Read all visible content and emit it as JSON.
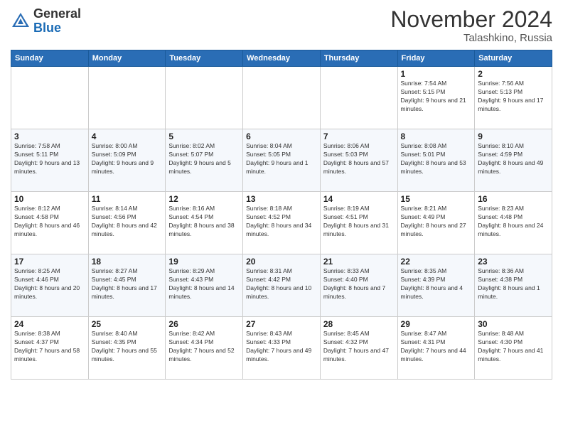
{
  "header": {
    "logo_general": "General",
    "logo_blue": "Blue",
    "month_title": "November 2024",
    "location": "Talashkino, Russia"
  },
  "calendar": {
    "days_of_week": [
      "Sunday",
      "Monday",
      "Tuesday",
      "Wednesday",
      "Thursday",
      "Friday",
      "Saturday"
    ],
    "weeks": [
      [
        {
          "day": "",
          "info": ""
        },
        {
          "day": "",
          "info": ""
        },
        {
          "day": "",
          "info": ""
        },
        {
          "day": "",
          "info": ""
        },
        {
          "day": "",
          "info": ""
        },
        {
          "day": "1",
          "info": "Sunrise: 7:54 AM\nSunset: 5:15 PM\nDaylight: 9 hours and 21 minutes."
        },
        {
          "day": "2",
          "info": "Sunrise: 7:56 AM\nSunset: 5:13 PM\nDaylight: 9 hours and 17 minutes."
        }
      ],
      [
        {
          "day": "3",
          "info": "Sunrise: 7:58 AM\nSunset: 5:11 PM\nDaylight: 9 hours and 13 minutes."
        },
        {
          "day": "4",
          "info": "Sunrise: 8:00 AM\nSunset: 5:09 PM\nDaylight: 9 hours and 9 minutes."
        },
        {
          "day": "5",
          "info": "Sunrise: 8:02 AM\nSunset: 5:07 PM\nDaylight: 9 hours and 5 minutes."
        },
        {
          "day": "6",
          "info": "Sunrise: 8:04 AM\nSunset: 5:05 PM\nDaylight: 9 hours and 1 minute."
        },
        {
          "day": "7",
          "info": "Sunrise: 8:06 AM\nSunset: 5:03 PM\nDaylight: 8 hours and 57 minutes."
        },
        {
          "day": "8",
          "info": "Sunrise: 8:08 AM\nSunset: 5:01 PM\nDaylight: 8 hours and 53 minutes."
        },
        {
          "day": "9",
          "info": "Sunrise: 8:10 AM\nSunset: 4:59 PM\nDaylight: 8 hours and 49 minutes."
        }
      ],
      [
        {
          "day": "10",
          "info": "Sunrise: 8:12 AM\nSunset: 4:58 PM\nDaylight: 8 hours and 46 minutes."
        },
        {
          "day": "11",
          "info": "Sunrise: 8:14 AM\nSunset: 4:56 PM\nDaylight: 8 hours and 42 minutes."
        },
        {
          "day": "12",
          "info": "Sunrise: 8:16 AM\nSunset: 4:54 PM\nDaylight: 8 hours and 38 minutes."
        },
        {
          "day": "13",
          "info": "Sunrise: 8:18 AM\nSunset: 4:52 PM\nDaylight: 8 hours and 34 minutes."
        },
        {
          "day": "14",
          "info": "Sunrise: 8:19 AM\nSunset: 4:51 PM\nDaylight: 8 hours and 31 minutes."
        },
        {
          "day": "15",
          "info": "Sunrise: 8:21 AM\nSunset: 4:49 PM\nDaylight: 8 hours and 27 minutes."
        },
        {
          "day": "16",
          "info": "Sunrise: 8:23 AM\nSunset: 4:48 PM\nDaylight: 8 hours and 24 minutes."
        }
      ],
      [
        {
          "day": "17",
          "info": "Sunrise: 8:25 AM\nSunset: 4:46 PM\nDaylight: 8 hours and 20 minutes."
        },
        {
          "day": "18",
          "info": "Sunrise: 8:27 AM\nSunset: 4:45 PM\nDaylight: 8 hours and 17 minutes."
        },
        {
          "day": "19",
          "info": "Sunrise: 8:29 AM\nSunset: 4:43 PM\nDaylight: 8 hours and 14 minutes."
        },
        {
          "day": "20",
          "info": "Sunrise: 8:31 AM\nSunset: 4:42 PM\nDaylight: 8 hours and 10 minutes."
        },
        {
          "day": "21",
          "info": "Sunrise: 8:33 AM\nSunset: 4:40 PM\nDaylight: 8 hours and 7 minutes."
        },
        {
          "day": "22",
          "info": "Sunrise: 8:35 AM\nSunset: 4:39 PM\nDaylight: 8 hours and 4 minutes."
        },
        {
          "day": "23",
          "info": "Sunrise: 8:36 AM\nSunset: 4:38 PM\nDaylight: 8 hours and 1 minute."
        }
      ],
      [
        {
          "day": "24",
          "info": "Sunrise: 8:38 AM\nSunset: 4:37 PM\nDaylight: 7 hours and 58 minutes."
        },
        {
          "day": "25",
          "info": "Sunrise: 8:40 AM\nSunset: 4:35 PM\nDaylight: 7 hours and 55 minutes."
        },
        {
          "day": "26",
          "info": "Sunrise: 8:42 AM\nSunset: 4:34 PM\nDaylight: 7 hours and 52 minutes."
        },
        {
          "day": "27",
          "info": "Sunrise: 8:43 AM\nSunset: 4:33 PM\nDaylight: 7 hours and 49 minutes."
        },
        {
          "day": "28",
          "info": "Sunrise: 8:45 AM\nSunset: 4:32 PM\nDaylight: 7 hours and 47 minutes."
        },
        {
          "day": "29",
          "info": "Sunrise: 8:47 AM\nSunset: 4:31 PM\nDaylight: 7 hours and 44 minutes."
        },
        {
          "day": "30",
          "info": "Sunrise: 8:48 AM\nSunset: 4:30 PM\nDaylight: 7 hours and 41 minutes."
        }
      ]
    ]
  }
}
